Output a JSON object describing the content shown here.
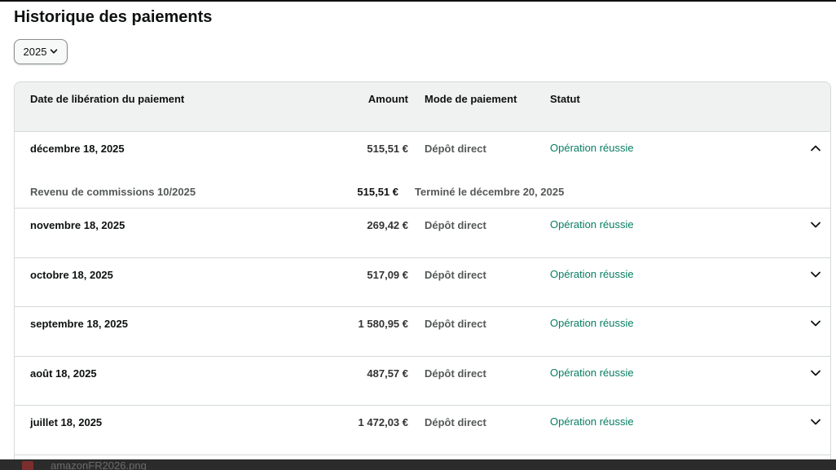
{
  "page": {
    "title": "Historique des paiements"
  },
  "year_select": {
    "value": "2025",
    "icon": "chevron-down-icon"
  },
  "table": {
    "headers": {
      "date": "Date de libération du paiement",
      "amount": "Amount",
      "mode": "Mode de paiement",
      "status": "Statut"
    },
    "rows": [
      {
        "date": "décembre 18, 2025",
        "amount": "515,51 €",
        "mode": "Dépôt direct",
        "status": "Opération réussie",
        "expanded": true,
        "detail": {
          "label": "Revenu de commissions 10/2025",
          "amount": "515,51 €",
          "completed": "Terminé le décembre 20, 2025"
        }
      },
      {
        "date": "novembre 18, 2025",
        "amount": "269,42 €",
        "mode": "Dépôt direct",
        "status": "Opération réussie",
        "expanded": false
      },
      {
        "date": "octobre 18, 2025",
        "amount": "517,09 €",
        "mode": "Dépôt direct",
        "status": "Opération réussie",
        "expanded": false
      },
      {
        "date": "septembre 18, 2025",
        "amount": "1 580,95 €",
        "mode": "Dépôt direct",
        "status": "Opération réussie",
        "expanded": false
      },
      {
        "date": "août 18, 2025",
        "amount": "487,57 €",
        "mode": "Dépôt direct",
        "status": "Opération réussie",
        "expanded": false
      },
      {
        "date": "juillet 18, 2025",
        "amount": "1 472,03 €",
        "mode": "Dépôt direct",
        "status": "Opération réussie",
        "expanded": false
      }
    ]
  },
  "bottom_bar": {
    "file_name": "amazonFR2026.png"
  },
  "colors": {
    "status_success": "#067d62",
    "header_bg": "#f0f2f2",
    "border": "#d5d9d9"
  }
}
